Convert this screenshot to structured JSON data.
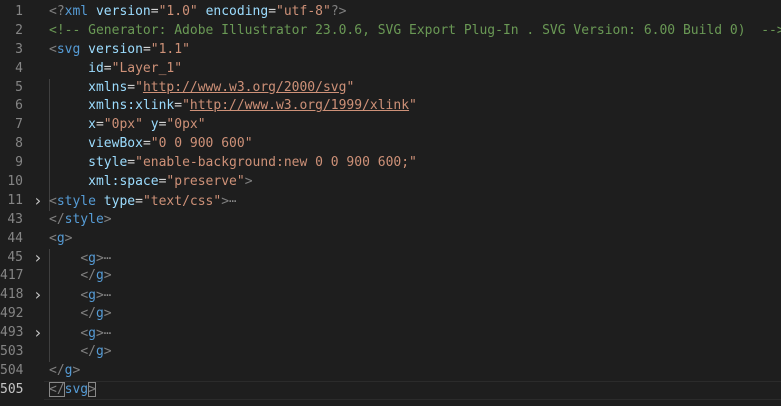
{
  "lines": [
    {
      "num": "1",
      "prefix": "",
      "text": "<?xml version=\"1.0\" encoding=\"utf-8\"?>"
    },
    {
      "num": "2",
      "prefix": "",
      "text": "<!-- Generator: Adobe Illustrator 23.0.6, SVG Export Plug-In . SVG Version: 6.00 Build 0)  -->"
    },
    {
      "num": "3",
      "prefix": "",
      "text": "<svg version=\"1.1\""
    },
    {
      "num": "4",
      "prefix": "     ",
      "text": "id=\"Layer_1\""
    },
    {
      "num": "5",
      "prefix": "     ",
      "text": "xmlns=\"http://www.w3.org/2000/svg\""
    },
    {
      "num": "6",
      "prefix": "     ",
      "text": "xmlns:xlink=\"http://www.w3.org/1999/xlink\""
    },
    {
      "num": "7",
      "prefix": "     ",
      "text": "x=\"0px\" y=\"0px\""
    },
    {
      "num": "8",
      "prefix": "     ",
      "text": "viewBox=\"0 0 900 600\""
    },
    {
      "num": "9",
      "prefix": "     ",
      "text": "style=\"enable-background:new 0 0 900 600;\""
    },
    {
      "num": "10",
      "prefix": "     ",
      "text": "xml:space=\"preserve\">"
    },
    {
      "num": "11",
      "prefix": "",
      "text": "<style type=\"text/css\">",
      "folded": true,
      "ellipsis": "⋯"
    },
    {
      "num": "43",
      "prefix": "",
      "text": "</style>"
    },
    {
      "num": "44",
      "prefix": "",
      "text": "<g>"
    },
    {
      "num": "45",
      "prefix": "    ",
      "text": "<g>",
      "folded": true,
      "ellipsis": "⋯"
    },
    {
      "num": "417",
      "prefix": "    ",
      "text": "</g>"
    },
    {
      "num": "418",
      "prefix": "    ",
      "text": "<g>",
      "folded": true,
      "ellipsis": "⋯"
    },
    {
      "num": "492",
      "prefix": "    ",
      "text": "</g>"
    },
    {
      "num": "493",
      "prefix": "    ",
      "text": "<g>",
      "folded": true,
      "ellipsis": "⋯"
    },
    {
      "num": "503",
      "prefix": "    ",
      "text": "</g>"
    },
    {
      "num": "504",
      "prefix": "",
      "text": "</g>"
    },
    {
      "num": "505",
      "prefix": "",
      "text": "</svg>",
      "current": true
    }
  ],
  "icons": {
    "fold": "chevron-right-icon"
  },
  "colors": {
    "background": "#1e1e1e",
    "tag": "#569cd6",
    "attribute": "#9cdcfe",
    "string": "#ce9178",
    "comment": "#6a9955",
    "punctuation": "#808080",
    "line_number": "#858585",
    "current_line_number": "#c6c6c6"
  }
}
